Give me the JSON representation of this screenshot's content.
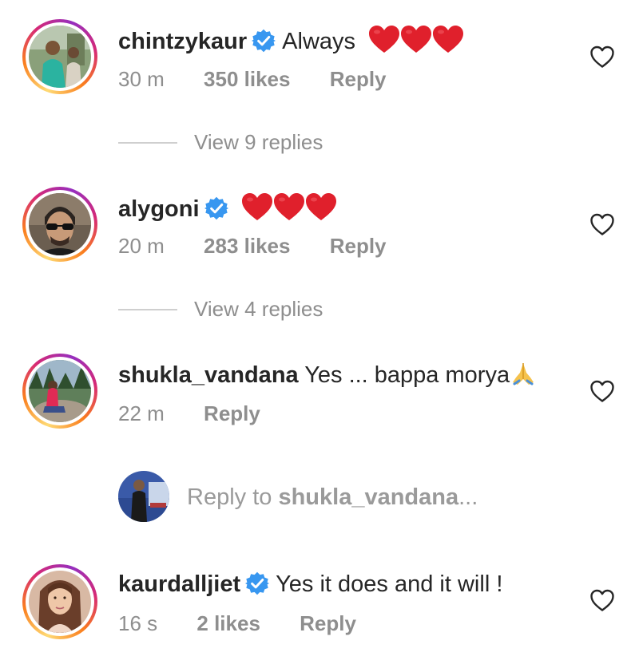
{
  "comments": [
    {
      "username": "chintzykaur",
      "verified": true,
      "text": "Always",
      "hearts": 3,
      "time": "30 m",
      "likes": "350 likes",
      "reply_label": "Reply",
      "view_replies": "View 9 replies"
    },
    {
      "username": "alygoni",
      "verified": true,
      "text": "",
      "hearts": 3,
      "time": "20 m",
      "likes": "283 likes",
      "reply_label": "Reply",
      "view_replies": "View 4 replies"
    },
    {
      "username": "shukla_vandana",
      "verified": false,
      "text": "Yes ... bappa morya",
      "emoji": "folded-hands",
      "time": "22 m",
      "likes": "",
      "reply_label": "Reply"
    },
    {
      "username": "kaurdalljiet",
      "verified": true,
      "text": "Yes it does and it will !",
      "time": "16 s",
      "likes": "2 likes",
      "reply_label": "Reply"
    }
  ],
  "reply_composer": {
    "prefix": "Reply to ",
    "username": "shukla_vandana",
    "suffix": "..."
  },
  "colors": {
    "text": "#262626",
    "muted": "#8e8e8e",
    "verified_blue": "#3897f0",
    "heart_red": "#e0202c"
  },
  "icons": {
    "verified": "verified-badge-icon",
    "like": "heart-outline-icon",
    "heart": "red-heart-emoji",
    "hands": "folded-hands-emoji"
  }
}
